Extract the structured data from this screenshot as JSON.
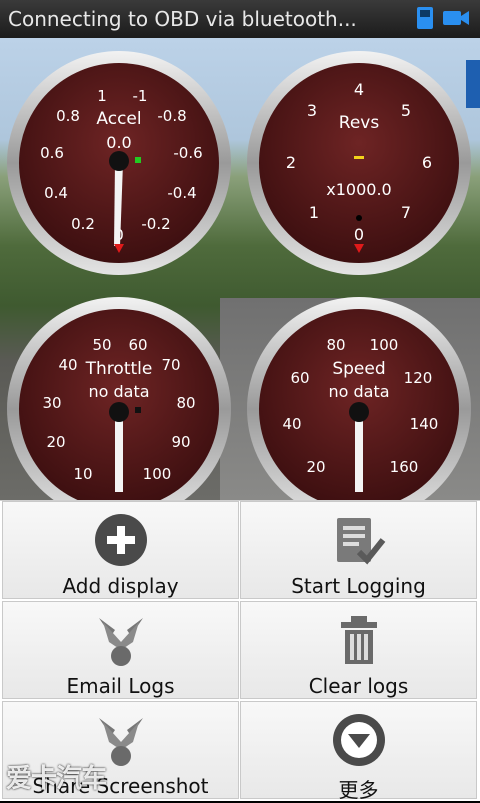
{
  "status_bar": {
    "title": "Connecting to OBD via bluetooth...",
    "icons": [
      "sim-card-icon",
      "video-camera-icon"
    ]
  },
  "gauges": [
    {
      "id": "accel",
      "title": "Accel",
      "sub": "0.0",
      "ticks": [
        "1",
        "-1",
        "0.8",
        "-0.8",
        "0.6",
        "-0.6",
        "0.4",
        "-0.4",
        "0.2",
        "-0.2",
        "0"
      ],
      "needle_value": "0",
      "indicator_color": "#22cc22"
    },
    {
      "id": "revs",
      "title": "Revs",
      "sub": "x1000.0",
      "ticks": [
        "4",
        "3",
        "5",
        "2",
        "6",
        "1",
        "7",
        "0"
      ],
      "needle_value": "0",
      "indicator_color": "#f2d21b"
    },
    {
      "id": "throttle",
      "title": "Throttle",
      "sub": "no data",
      "ticks": [
        "50",
        "60",
        "40",
        "70",
        "30",
        "80",
        "20",
        "90",
        "10",
        "100"
      ]
    },
    {
      "id": "speed",
      "title": "Speed",
      "sub": "no data",
      "ticks": [
        "80",
        "100",
        "60",
        "120",
        "40",
        "140",
        "20",
        "160"
      ]
    }
  ],
  "menu": {
    "items": [
      {
        "label": "Add display",
        "icon": "add-circle-icon"
      },
      {
        "label": "Start Logging",
        "icon": "checklist-icon"
      },
      {
        "label": "Email Logs",
        "icon": "share-icon"
      },
      {
        "label": "Clear logs",
        "icon": "trash-icon"
      },
      {
        "label": "Share Screenshot",
        "icon": "share-icon"
      },
      {
        "label": "更多",
        "icon": "more-down-icon"
      }
    ]
  },
  "watermark": "爱卡汽车",
  "colors": {
    "gauge_face": "#5a1a1a",
    "bezel": "#c8c8c8",
    "accent_red": "#c0202a"
  }
}
